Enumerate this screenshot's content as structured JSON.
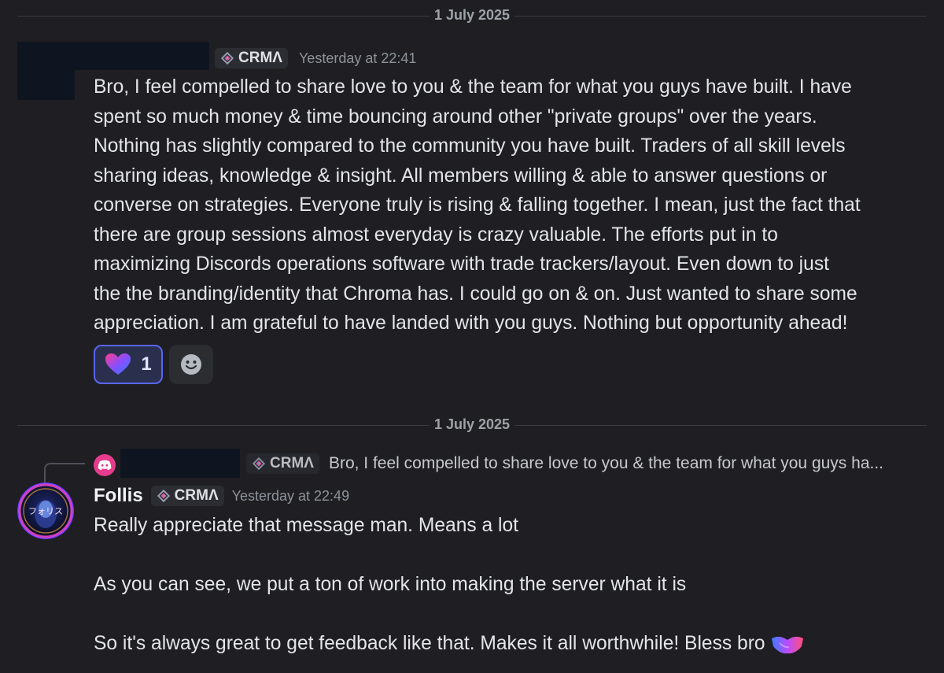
{
  "dividers": [
    {
      "label": "1 July 2025"
    },
    {
      "label": "1 July 2025"
    }
  ],
  "messages": [
    {
      "tag": "CRMΛ",
      "timestamp": "Yesterday at 22:41",
      "text": "Bro, I feel compelled to share love to you & the team for what you guys have built. I have\nspent so much money & time bouncing around other \"private groups\" over the years.\nNothing has slightly compared to the community you have built. Traders of all skill levels\nsharing ideas, knowledge & insight. All members willing & able to answer questions or\nconverse on strategies. Everyone truly is rising & falling together. I mean, just the fact that\nthere are group sessions almost everyday is crazy valuable. The efforts put in to\nmaximizing Discords operations software with trade trackers/layout. Even down to just\nthe the branding/identity that Chroma has. I could go on & on. Just wanted to share some\nappreciation. I am grateful to have landed with you guys. Nothing but opportunity ahead!",
      "reaction": {
        "emoji": "gradient-heart",
        "count": "1"
      }
    },
    {
      "reply": {
        "tag": "CRMΛ",
        "preview": "Bro, I feel compelled to share love to you & the team for what you guys ha..."
      },
      "avatar_text": "フォリス",
      "username": "Follis",
      "tag": "CRMΛ",
      "timestamp": "Yesterday at 22:49",
      "lines": [
        "Really appreciate that message man. Means a lot",
        "As you can see, we put a ton of work into making the server what it is",
        "So it's always great to get feedback like that. Makes it all worthwhile! Bless bro"
      ]
    }
  ],
  "colors": {
    "background": "#1f1f23",
    "accent": "#5865f2",
    "redacted": "#0f1520"
  }
}
